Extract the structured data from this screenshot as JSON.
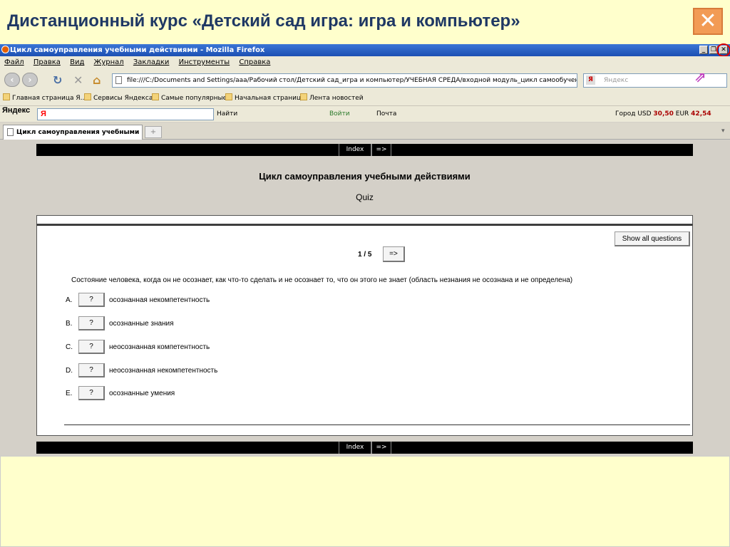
{
  "slide": {
    "title": "Дистанционный курс «Детский сад игра: игра и компьютер»",
    "close_symbol": "✕"
  },
  "window": {
    "title": "Цикл самоуправления учебными действиями - Mozilla Firefox",
    "buttons": [
      "_",
      "❐",
      "✕"
    ]
  },
  "menu": [
    "Файл",
    "Правка",
    "Вид",
    "Журнал",
    "Закладки",
    "Инструменты",
    "Справка"
  ],
  "nav": {
    "url": "file:///C:/Documents and Settings/ааа/Рабочий стол/Детский сад_игра и компьютер/УЧЕБНАЯ СРЕДА/входной модуль_цикл самообучения/УЧЕБ",
    "search_placeholder": "Яндекс",
    "engine_icon": "Я"
  },
  "bookmarks": [
    "Главная страница Я...",
    "Сервисы Яндекса",
    "Самые популярные",
    "Начальная страница",
    "Лента новостей"
  ],
  "yandex_bar": {
    "logo": "Яндекс",
    "input_value": "Я",
    "find": "Найти",
    "login": "Войти",
    "mail": "Почта",
    "city": "Город",
    "usd_label": "USD",
    "usd": "30,50",
    "eur_label": "EUR",
    "eur": "42,54"
  },
  "tab": {
    "label": "Цикл самоуправления учебными д...",
    "new_symbol": "+"
  },
  "page": {
    "index_label": "Index",
    "arrow_label": "=>",
    "title": "Цикл самоуправления учебными действиями",
    "subtitle": "Quiz",
    "show_all": "Show all questions",
    "counter": "1 / 5",
    "question": "Состояние человека, когда он не осознает, как что-то сделать и не осознает то, что он этого не знает (область незнания не осознана и не определена)",
    "options": [
      {
        "letter": "A.",
        "button": "?",
        "text": "осознанная некомпетентность"
      },
      {
        "letter": "B.",
        "button": "?",
        "text": "осознанные знания"
      },
      {
        "letter": "C.",
        "button": "?",
        "text": "неосознанная компетентность"
      },
      {
        "letter": "D.",
        "button": "?",
        "text": "неосознанная некомпетентность"
      },
      {
        "letter": "E.",
        "button": "?",
        "text": "осознанные умения"
      }
    ]
  }
}
